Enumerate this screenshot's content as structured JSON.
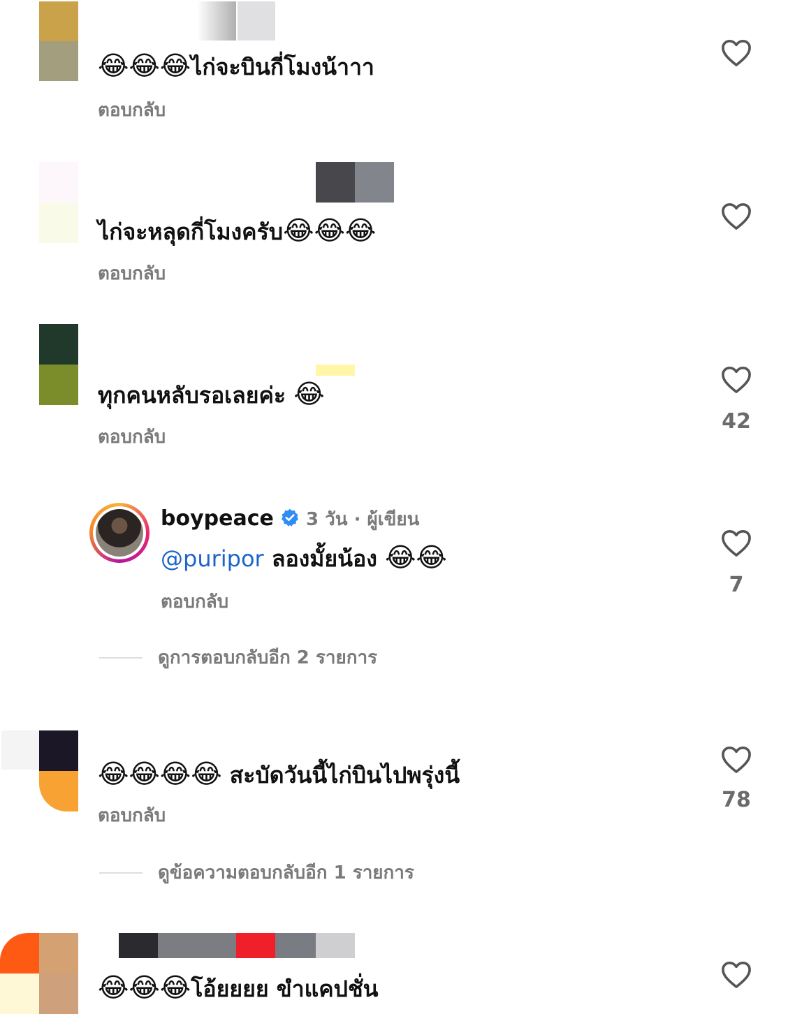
{
  "comments": [
    {
      "emoji_prefix": "😂😂😂",
      "text": "ไก่จะบินกี่โมงน้าาา",
      "emoji_suffix": "",
      "reply_label": "ตอบกลับ",
      "likes": ""
    },
    {
      "emoji_prefix": "",
      "text": "ไก่จะหลุดกี่โมงครับ",
      "emoji_suffix": "😂😂😂",
      "reply_label": "ตอบกลับ",
      "likes": ""
    },
    {
      "emoji_prefix": "",
      "text": "ทุกคนหลับรอเลยค่ะ ",
      "emoji_suffix": "😂",
      "reply_label": "ตอบกลับ",
      "likes": "42"
    },
    {
      "emoji_prefix": "😂😂😂😂",
      "text": " สะบัดวันนี้ไก่บินไปพรุ่งนี้",
      "emoji_suffix": "",
      "reply_label": "ตอบกลับ",
      "likes": "78"
    },
    {
      "emoji_prefix": "😂😂😂",
      "text": "โอ้ยยยย ขำแคปชั่น",
      "emoji_suffix": "",
      "reply_label": "",
      "likes": ""
    }
  ],
  "reply": {
    "username": "boypeace",
    "meta": "3 วัน · ผู้เขียน",
    "mention": "@puripor",
    "text": " ลองมั้ยน้อง ",
    "emoji_suffix": "😂😂",
    "reply_label": "ตอบกลับ",
    "likes": "7"
  },
  "view_more": [
    "ดูการตอบกลับอีก 2 รายการ",
    "ดูข้อความตอบกลับอีก 1 รายการ"
  ],
  "colors": {
    "mention": "#1e64c8",
    "verified": "#2f8cf0",
    "muted": "#7a7a7a"
  },
  "icons": [
    "heart-icon",
    "verified-badge-icon"
  ]
}
